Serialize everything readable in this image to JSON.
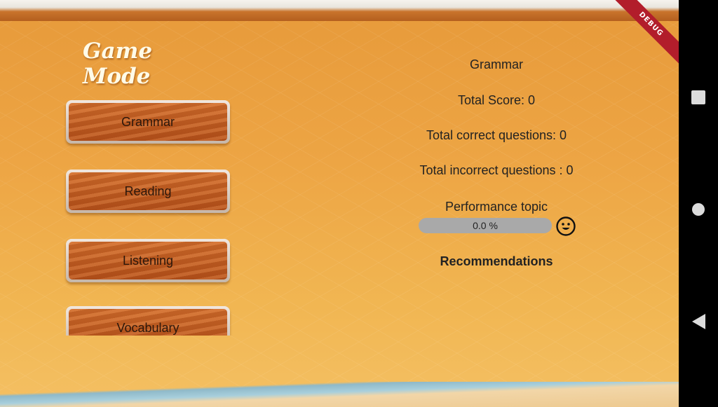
{
  "app": {
    "title": "Game Mode",
    "debug_banner": "DEBUG"
  },
  "menu": {
    "buttons": [
      {
        "label": "Grammar"
      },
      {
        "label": "Reading"
      },
      {
        "label": "Listening"
      },
      {
        "label": "Vocabulary"
      }
    ]
  },
  "stats": {
    "topic": "Grammar",
    "total_score": "Total Score:  0",
    "total_correct": "Total correct questions:  0",
    "total_incorrect": "Total incorrect questions : 0",
    "performance_label": "Performance topic",
    "performance_percent": "0.0 %",
    "performance_fraction": 0.0,
    "recommendations": "Recommendations"
  },
  "colors": {
    "background": "#eda544",
    "button_wood": "#c25f25",
    "progress_track": "#a9a9a9",
    "debug_banner": "#b21d2b"
  },
  "icons": {
    "performance": "smiley-face-icon",
    "nav_recents": "square-icon",
    "nav_home": "circle-icon",
    "nav_back": "back-triangle-icon"
  }
}
